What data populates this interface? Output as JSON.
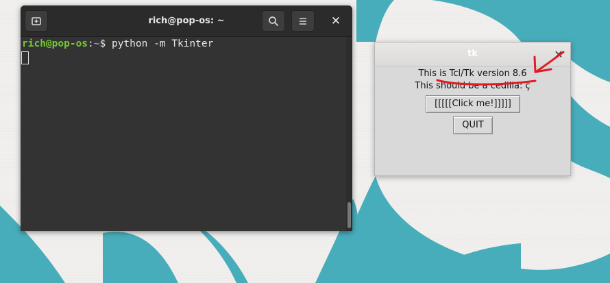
{
  "terminal": {
    "title": "rich@pop-os: ~",
    "prompt_user_host": "rich@pop-os",
    "prompt_colon": ":",
    "prompt_path": "~",
    "prompt_symbol": "$ ",
    "command": "python -m Tkinter",
    "icons": {
      "new_tab": "new-tab-icon",
      "search": "search-icon",
      "menu": "hamburger-menu-icon",
      "close": "close-icon"
    },
    "close_glyph": "✕"
  },
  "tk_window": {
    "title": "tk",
    "close_glyph": "✕",
    "version_label": "This is Tcl/Tk version 8.6",
    "cedilla_label": "This should be a cedilla: ç",
    "click_button_label": "[[[[[Click me!]]]]]",
    "quit_button_label": "QUIT"
  },
  "colors": {
    "wallpaper_shapes": "#48adbb",
    "wallpaper_bg": "#f1f0ee",
    "terminal_bg": "#333333",
    "prompt_green": "#73c936",
    "prompt_blue": "#6ea0d8",
    "annotation_red": "#e01b24"
  }
}
